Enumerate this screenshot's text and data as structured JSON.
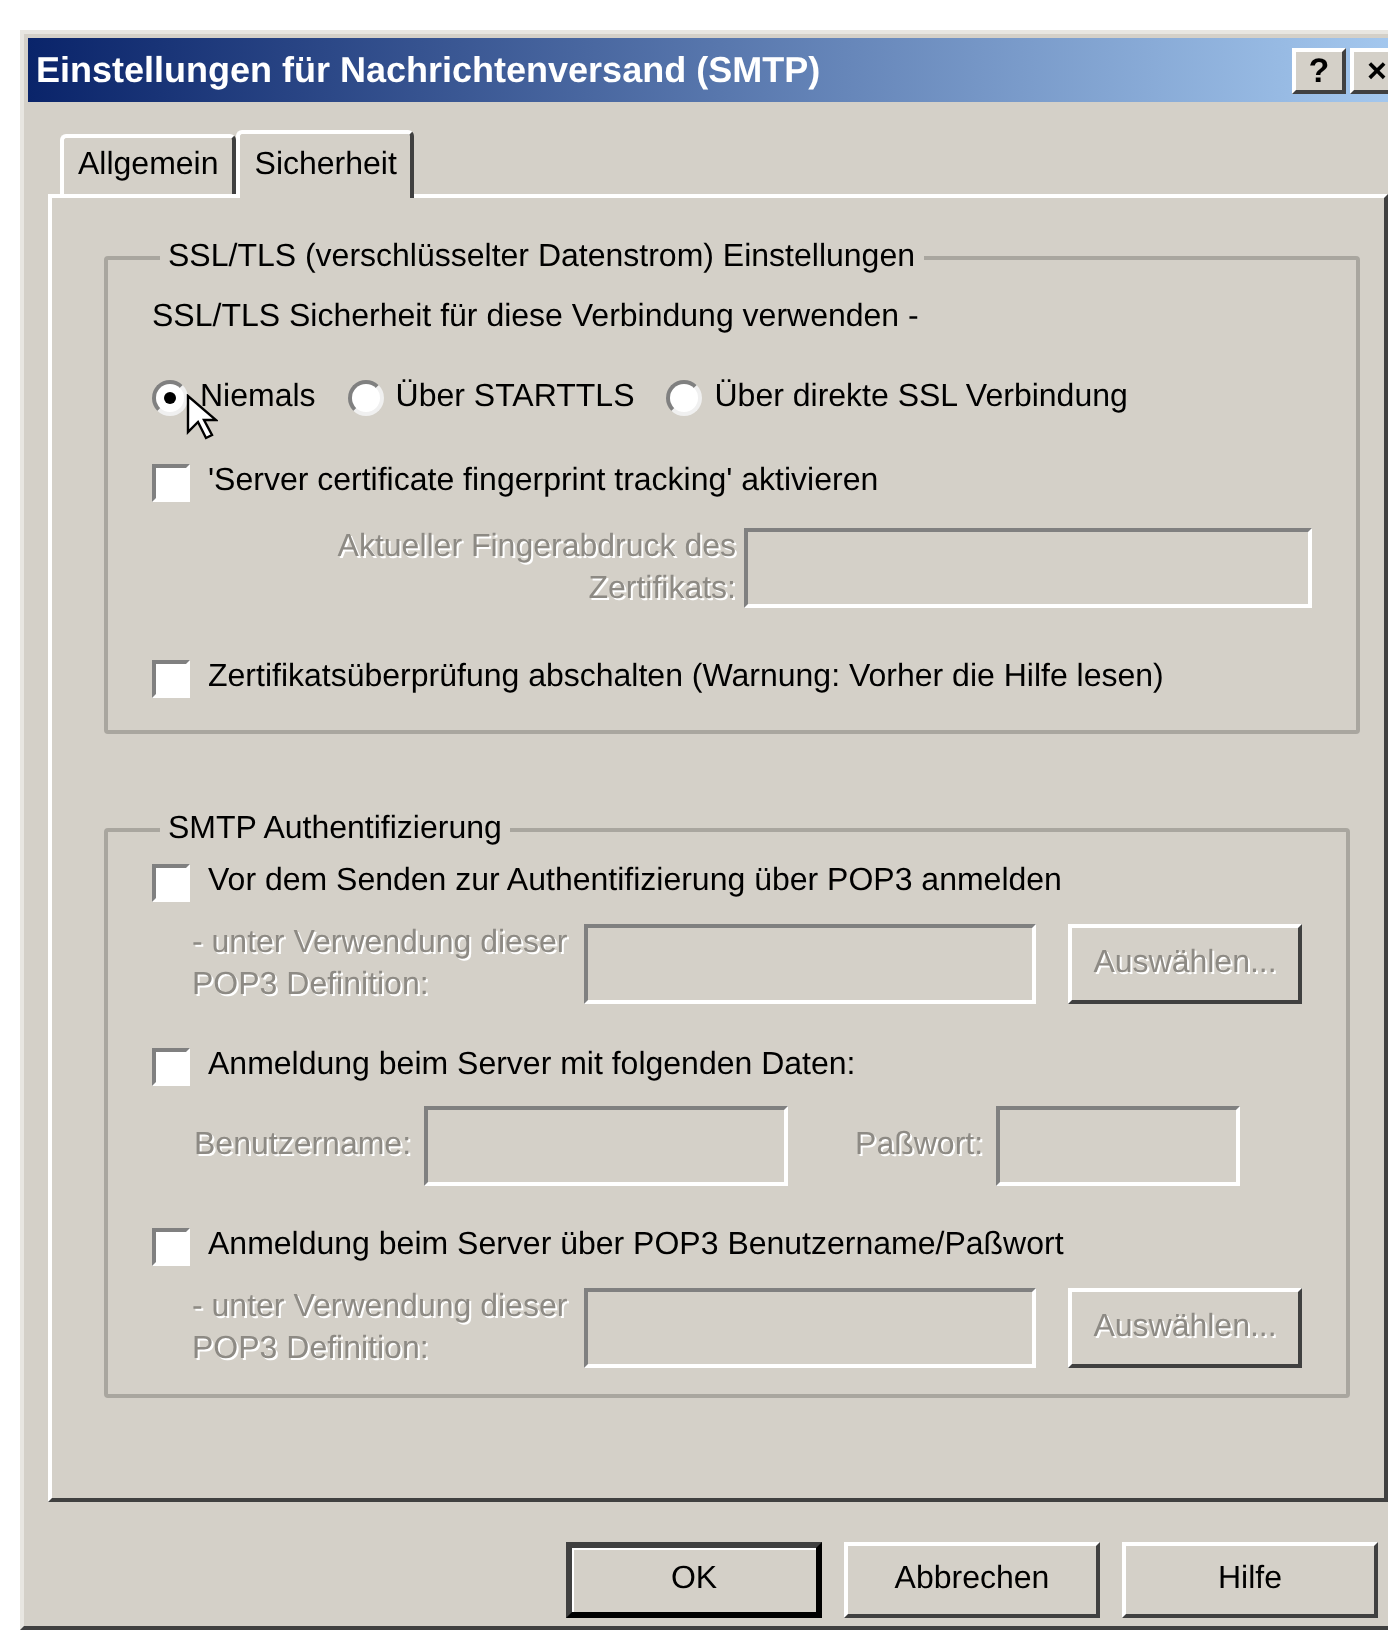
{
  "window": {
    "title": "Einstellungen für Nachrichtenversand (SMTP)",
    "title_buttons": [
      "?",
      "×"
    ]
  },
  "tabs": [
    {
      "label": "Allgemein",
      "selected": false
    },
    {
      "label": "Sicherheit",
      "selected": true
    }
  ],
  "ssl_group": {
    "title": "SSL/TLS (verschlüsselter Datenstrom) Einstellungen",
    "prompt": "SSL/TLS Sicherheit für diese Verbindung verwenden -",
    "radios": [
      {
        "label": "Niemals",
        "selected": true
      },
      {
        "label": "Über STARTTLS",
        "selected": false
      },
      {
        "label": "Über direkte SSL Verbindung",
        "selected": false
      }
    ],
    "fingerprint_checkbox": {
      "label": "'Server certificate fingerprint tracking' aktivieren",
      "checked": false
    },
    "fingerprint_field": {
      "label": "Aktueller Fingerabdruck des Zertifikats:",
      "disabled": true
    },
    "disable_check_checkbox": {
      "label": "Zertifikatsüberprüfung abschalten (Warnung: Vorher die Hilfe lesen)",
      "checked": false
    }
  },
  "auth_group": {
    "title": "SMTP Authentifizierung",
    "options": [
      {
        "kind": "pop3",
        "label": "Vor dem Senden zur Authentifizierung über POP3 anmelden",
        "checked": false,
        "field_label": "- unter Verwendung dieser POP3 Definition:",
        "button": "Auswählen...",
        "disabled": true
      },
      {
        "kind": "credentials",
        "label": "Anmeldung beim Server mit folgenden Daten:",
        "checked": false,
        "username_label": "Benutzername:",
        "password_label": "Paßwort:",
        "disabled": true
      },
      {
        "kind": "pop3",
        "label": "Anmeldung beim Server über POP3 Benutzername/Paßwort",
        "checked": false,
        "field_label": "- unter Verwendung dieser POP3 Definition:",
        "button": "Auswählen...",
        "disabled": true
      }
    ]
  },
  "buttons": [
    {
      "label": "OK",
      "default": true
    },
    {
      "label": "Abbrechen",
      "default": false
    },
    {
      "label": "Hilfe",
      "default": false
    }
  ]
}
